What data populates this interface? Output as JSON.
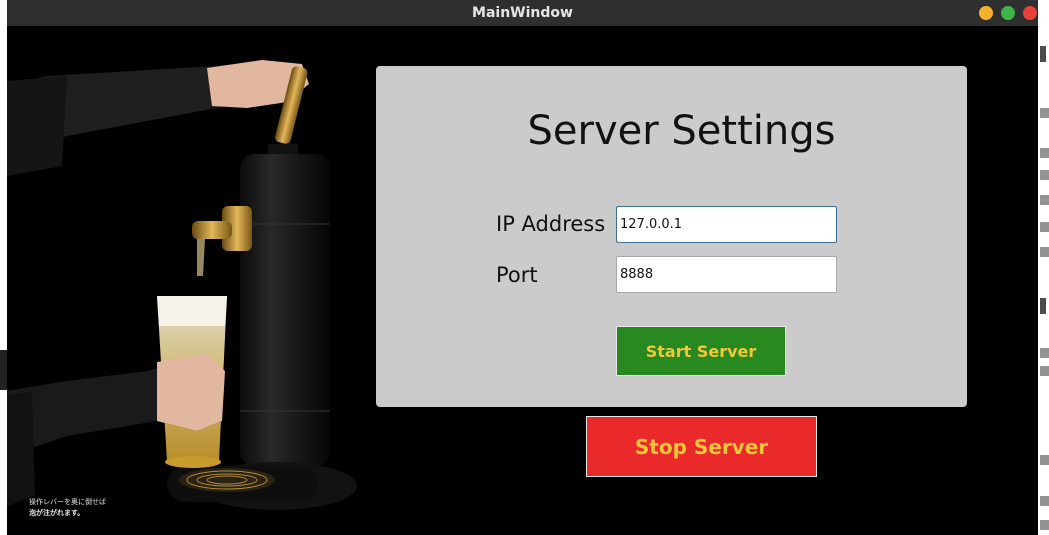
{
  "window": {
    "title": "MainWindow"
  },
  "illustration": {
    "caption_line1": "操作レバーを奥に倒せば",
    "caption_line2": "泡が注がれます。"
  },
  "settings": {
    "title": "Server Settings",
    "ip_label": "IP Address",
    "ip_value": "127.0.0.1",
    "port_label": "Port",
    "port_value": "8888",
    "start_label": "Start Server",
    "stop_label": "Stop Server"
  },
  "colors": {
    "panel_bg": "#cbcbcb",
    "start_bg": "#27891f",
    "stop_bg": "#ea2a2a",
    "button_text": "#f4c63a",
    "titlebar": "#2f2f2f"
  }
}
